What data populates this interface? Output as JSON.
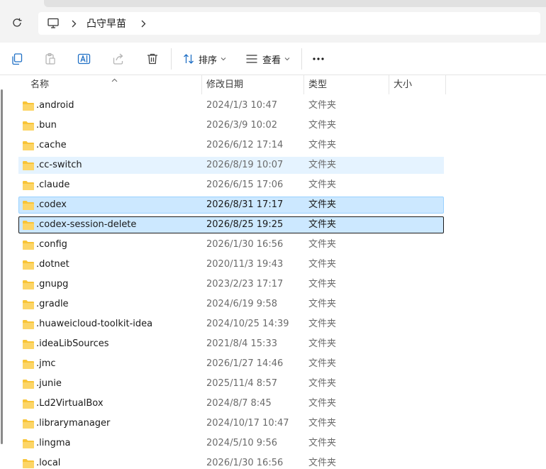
{
  "window": {
    "refresh_icon": "refresh-icon",
    "pc_icon": "this-pc-icon",
    "breadcrumb": [
      ".",
      "凸守早苗"
    ]
  },
  "toolbar": {
    "copy_icon": "copy-icon",
    "paste_icon": "paste-icon",
    "rename_icon": "rename-icon",
    "share_icon": "share-icon",
    "delete_icon": "delete-icon",
    "sort_label": "排序",
    "view_label": "查看",
    "more_icon": "more-icon"
  },
  "columns": {
    "name": "名称",
    "modified": "修改日期",
    "type": "类型",
    "size": "大小"
  },
  "colors": {
    "folder": "#f8c437",
    "hover": "#e5f3ff",
    "selected": "#cce8ff",
    "selected_border": "#99d1ff"
  },
  "files": [
    {
      "name": ".android",
      "modified": "2024/1/3 10:47",
      "type": "文件夹",
      "size": "",
      "state": "normal"
    },
    {
      "name": ".bun",
      "modified": "2026/3/9 10:02",
      "type": "文件夹",
      "size": "",
      "state": "normal"
    },
    {
      "name": ".cache",
      "modified": "2026/6/12 17:14",
      "type": "文件夹",
      "size": "",
      "state": "normal"
    },
    {
      "name": ".cc-switch",
      "modified": "2026/8/19 10:07",
      "type": "文件夹",
      "size": "",
      "state": "hover"
    },
    {
      "name": ".claude",
      "modified": "2026/6/15 17:06",
      "type": "文件夹",
      "size": "",
      "state": "normal"
    },
    {
      "name": ".codex",
      "modified": "2026/8/31 17:17",
      "type": "文件夹",
      "size": "",
      "state": "selected"
    },
    {
      "name": ".codex-session-delete",
      "modified": "2026/8/25 19:25",
      "type": "文件夹",
      "size": "",
      "state": "focused"
    },
    {
      "name": ".config",
      "modified": "2026/1/30 16:56",
      "type": "文件夹",
      "size": "",
      "state": "normal"
    },
    {
      "name": ".dotnet",
      "modified": "2020/11/3 19:43",
      "type": "文件夹",
      "size": "",
      "state": "normal"
    },
    {
      "name": ".gnupg",
      "modified": "2023/2/23 17:17",
      "type": "文件夹",
      "size": "",
      "state": "normal"
    },
    {
      "name": ".gradle",
      "modified": "2024/6/19 9:58",
      "type": "文件夹",
      "size": "",
      "state": "normal"
    },
    {
      "name": ".huaweicloud-toolkit-idea",
      "modified": "2024/10/25 14:39",
      "type": "文件夹",
      "size": "",
      "state": "normal"
    },
    {
      "name": ".ideaLibSources",
      "modified": "2021/8/4 15:33",
      "type": "文件夹",
      "size": "",
      "state": "normal"
    },
    {
      "name": ".jmc",
      "modified": "2026/1/27 14:46",
      "type": "文件夹",
      "size": "",
      "state": "normal"
    },
    {
      "name": ".junie",
      "modified": "2025/11/4 8:57",
      "type": "文件夹",
      "size": "",
      "state": "normal"
    },
    {
      "name": ".Ld2VirtualBox",
      "modified": "2024/8/7 8:45",
      "type": "文件夹",
      "size": "",
      "state": "normal"
    },
    {
      "name": ".librarymanager",
      "modified": "2024/10/17 10:47",
      "type": "文件夹",
      "size": "",
      "state": "normal"
    },
    {
      "name": ".lingma",
      "modified": "2024/5/10 9:56",
      "type": "文件夹",
      "size": "",
      "state": "normal"
    },
    {
      "name": ".local",
      "modified": "2026/1/30 16:56",
      "type": "文件夹",
      "size": "",
      "state": "normal"
    }
  ]
}
